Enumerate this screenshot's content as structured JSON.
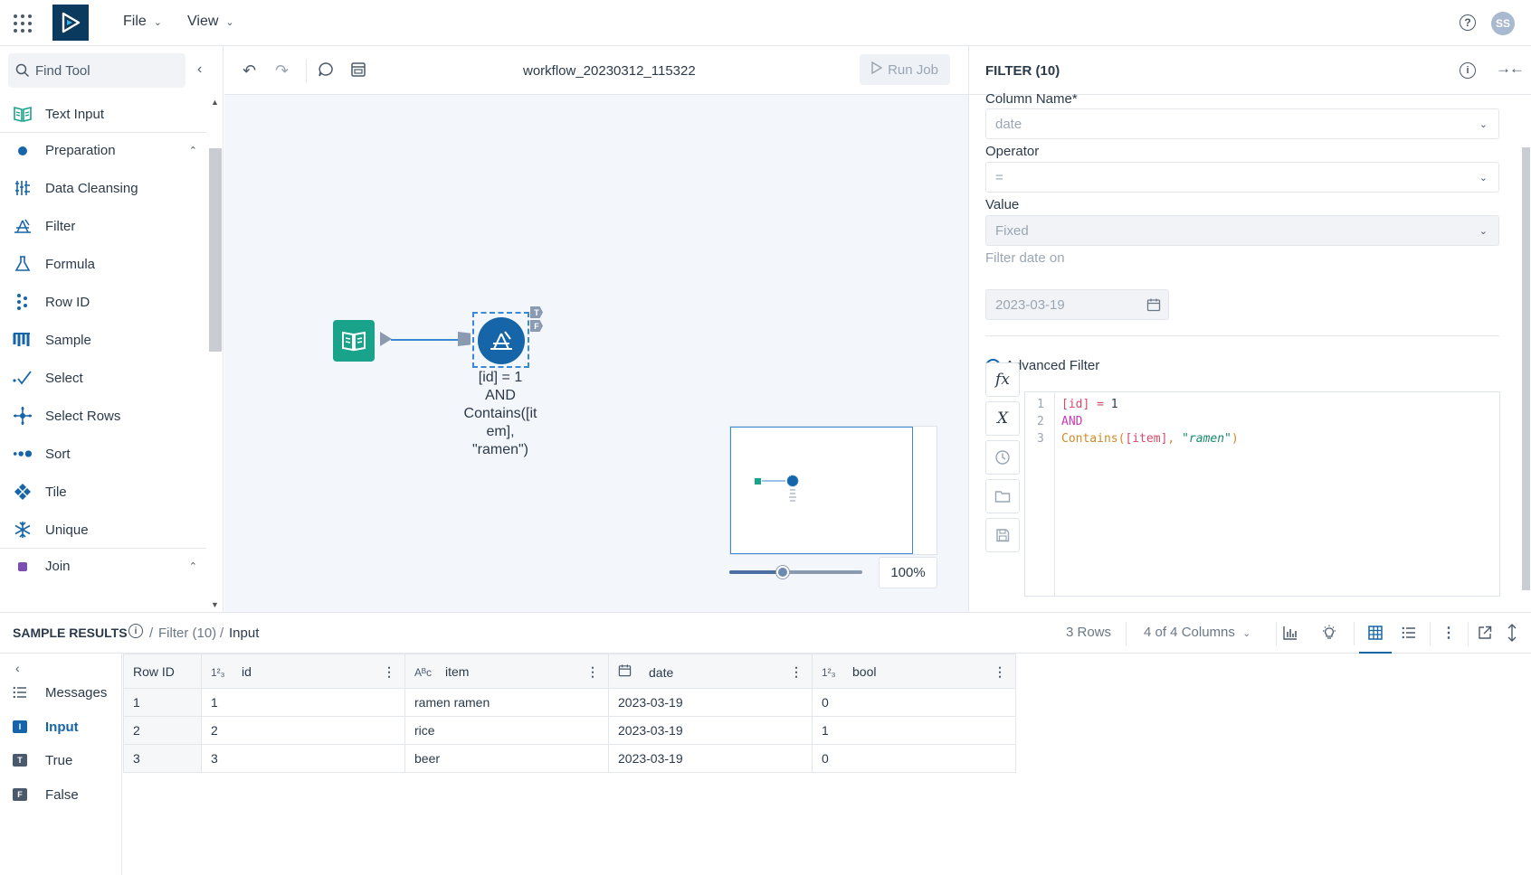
{
  "topbar": {
    "menus": [
      {
        "label": "File"
      },
      {
        "label": "View"
      }
    ],
    "help_icon": "?",
    "avatar_initials": "SS"
  },
  "palette": {
    "search_placeholder": "Find Tool",
    "items": [
      {
        "label": "Text Input",
        "icon": "book-icon",
        "color": "#18a38a"
      },
      {
        "label": "Preparation",
        "icon": "category-dot-icon",
        "color": "#1565a8",
        "category": true
      },
      {
        "label": "Data Cleansing",
        "icon": "cleanse-icon",
        "color": "#1565a8"
      },
      {
        "label": "Filter",
        "icon": "filter-icon",
        "color": "#1565a8"
      },
      {
        "label": "Formula",
        "icon": "flask-icon",
        "color": "#1565a8"
      },
      {
        "label": "Row ID",
        "icon": "row-id-icon",
        "color": "#1565a8"
      },
      {
        "label": "Sample",
        "icon": "sample-icon",
        "color": "#1565a8"
      },
      {
        "label": "Select",
        "icon": "check-icon",
        "color": "#1565a8"
      },
      {
        "label": "Select Rows",
        "icon": "crosshair-icon",
        "color": "#1565a8"
      },
      {
        "label": "Sort",
        "icon": "sort-icon",
        "color": "#1565a8"
      },
      {
        "label": "Tile",
        "icon": "tile-icon",
        "color": "#1565a8"
      },
      {
        "label": "Unique",
        "icon": "snowflake-icon",
        "color": "#1565a8"
      },
      {
        "label": "Join",
        "icon": "category-square-icon",
        "color": "#7a4fb0",
        "category": true
      }
    ]
  },
  "canvas": {
    "workflow_title": "workflow_20230312_115322",
    "run_job_label": "Run Job",
    "filter_node_label_lines": [
      "[id] = 1",
      "AND",
      "Contains([it",
      "em],",
      "\"ramen\")"
    ],
    "true_anchor": "T",
    "false_anchor": "F",
    "zoom_label": "100%",
    "zoom_level": 0.4
  },
  "config": {
    "title": "FILTER (10)",
    "column_name_label": "Column Name*",
    "column_name_value": "date",
    "operator_label": "Operator",
    "operator_value": "=",
    "value_label": "Value",
    "value_value": "Fixed",
    "filter_date_label": "Filter date on",
    "filter_date_value": "2023-03-19",
    "advanced_filter_label": "Advanced Filter",
    "editor_buttons": [
      {
        "label": "fx"
      },
      {
        "label": "X"
      }
    ],
    "code_lines": [
      {
        "num": "1",
        "parts": [
          {
            "t": "[id]",
            "c": "c-red"
          },
          {
            "t": " = ",
            "c": "c-red"
          },
          {
            "t": "1",
            "c": "c-dk"
          }
        ]
      },
      {
        "num": "2",
        "parts": [
          {
            "t": "AND",
            "c": "c-mag"
          }
        ]
      },
      {
        "num": "3",
        "parts": [
          {
            "t": "Contains(",
            "c": "c-org"
          },
          {
            "t": "[item]",
            "c": "c-red"
          },
          {
            "t": ", ",
            "c": "c-org"
          },
          {
            "t": "\"ramen\"",
            "c": "c-str"
          },
          {
            "t": ")",
            "c": "c-org"
          }
        ]
      }
    ]
  },
  "results": {
    "title": "SAMPLE RESULTS",
    "breadcrumb": [
      "Filter (10)",
      "Input"
    ],
    "row_count": "3 Rows",
    "columns_selector": "4 of 4 Columns",
    "side_items": [
      {
        "label": "Messages",
        "icon": "list-icon",
        "badge": ""
      },
      {
        "label": "Input",
        "icon": "input-badge-icon",
        "badge": "I",
        "active": true
      },
      {
        "label": "True",
        "icon": "true-badge-icon",
        "badge": "T"
      },
      {
        "label": "False",
        "icon": "false-badge-icon",
        "badge": "F"
      }
    ],
    "columns": [
      {
        "name": "Row ID",
        "type_icon": ""
      },
      {
        "name": "id",
        "type_icon": "1²₃"
      },
      {
        "name": "item",
        "type_icon": "Aᴮc"
      },
      {
        "name": "date",
        "type_icon": "cal"
      },
      {
        "name": "bool",
        "type_icon": "1²₃"
      }
    ],
    "rows": [
      [
        "1",
        "1",
        "ramen ramen",
        "2023-03-19",
        "0"
      ],
      [
        "2",
        "2",
        "rice",
        "2023-03-19",
        "1"
      ],
      [
        "3",
        "3",
        "beer",
        "2023-03-19",
        "0"
      ]
    ]
  }
}
